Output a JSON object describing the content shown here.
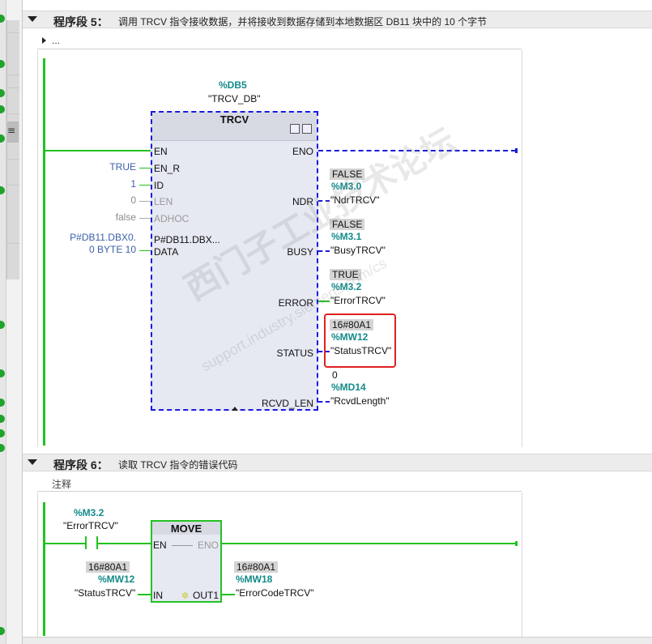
{
  "network5": {
    "label": "程序段 5：",
    "description": "调用 TRCV 指令接收数据，并将接收到数据存储到本地数据区 DB11 块中的 10 个字节",
    "comment": "..."
  },
  "trcv": {
    "db_address": "%DB5",
    "db_name": "\"TRCV_DB\"",
    "title": "TRCV",
    "inputs": {
      "en": "EN",
      "en_r": "EN_R",
      "id": "ID",
      "len": "LEN",
      "adhoc": "ADHOC",
      "data": "DATA"
    },
    "outputs": {
      "eno": "ENO",
      "ndr": "NDR",
      "busy": "BUSY",
      "error": "ERROR",
      "status": "STATUS",
      "rcvd_len": "RCVD_LEN"
    },
    "input_operands": {
      "en_r": "TRUE",
      "id": "1",
      "len": "0",
      "adhoc": "false",
      "data_line1": "P#DB11.DBX0.",
      "data_line2": "0 BYTE 10",
      "data_inside": "P#DB11.DBX..."
    },
    "output_operands": {
      "ndr": {
        "value": "FALSE",
        "address": "%M3.0",
        "tag": "\"NdrTRCV\""
      },
      "busy": {
        "value": "FALSE",
        "address": "%M3.1",
        "tag": "\"BusyTRCV\""
      },
      "error": {
        "value": "TRUE",
        "address": "%M3.2",
        "tag": "\"ErrorTRCV\""
      },
      "status": {
        "value": "16#80A1",
        "address": "%MW12",
        "tag": "\"StatusTRCV\""
      },
      "rcvd_len": {
        "value": "0",
        "address": "%MD14",
        "tag": "\"RcvdLength\""
      }
    }
  },
  "network6": {
    "label": "程序段 6：",
    "description": "读取 TRCV 指令的错误代码",
    "comment": "注释"
  },
  "move": {
    "title": "MOVE",
    "en": "EN",
    "eno": "ENO",
    "in": "IN",
    "out1": "OUT1",
    "contact_address": "%M3.2",
    "contact_tag": "\"ErrorTRCV\"",
    "in_value": "16#80A1",
    "in_address": "%MW12",
    "in_tag": "\"StatusTRCV\"",
    "out_value": "16#80A1",
    "out_address": "%MW18",
    "out_tag": "\"ErrorCodeTRCV\""
  },
  "watermark": {
    "cn": "西门子工业技术论坛",
    "en": "support.industry.siemens.com/cs"
  },
  "colors": {
    "rail_green": "#22c222",
    "dashed_blue": "#1a1ae0",
    "address_teal": "#138a8a",
    "operand_blue": "#3c5fa8",
    "highlight_red": "#e12020"
  }
}
